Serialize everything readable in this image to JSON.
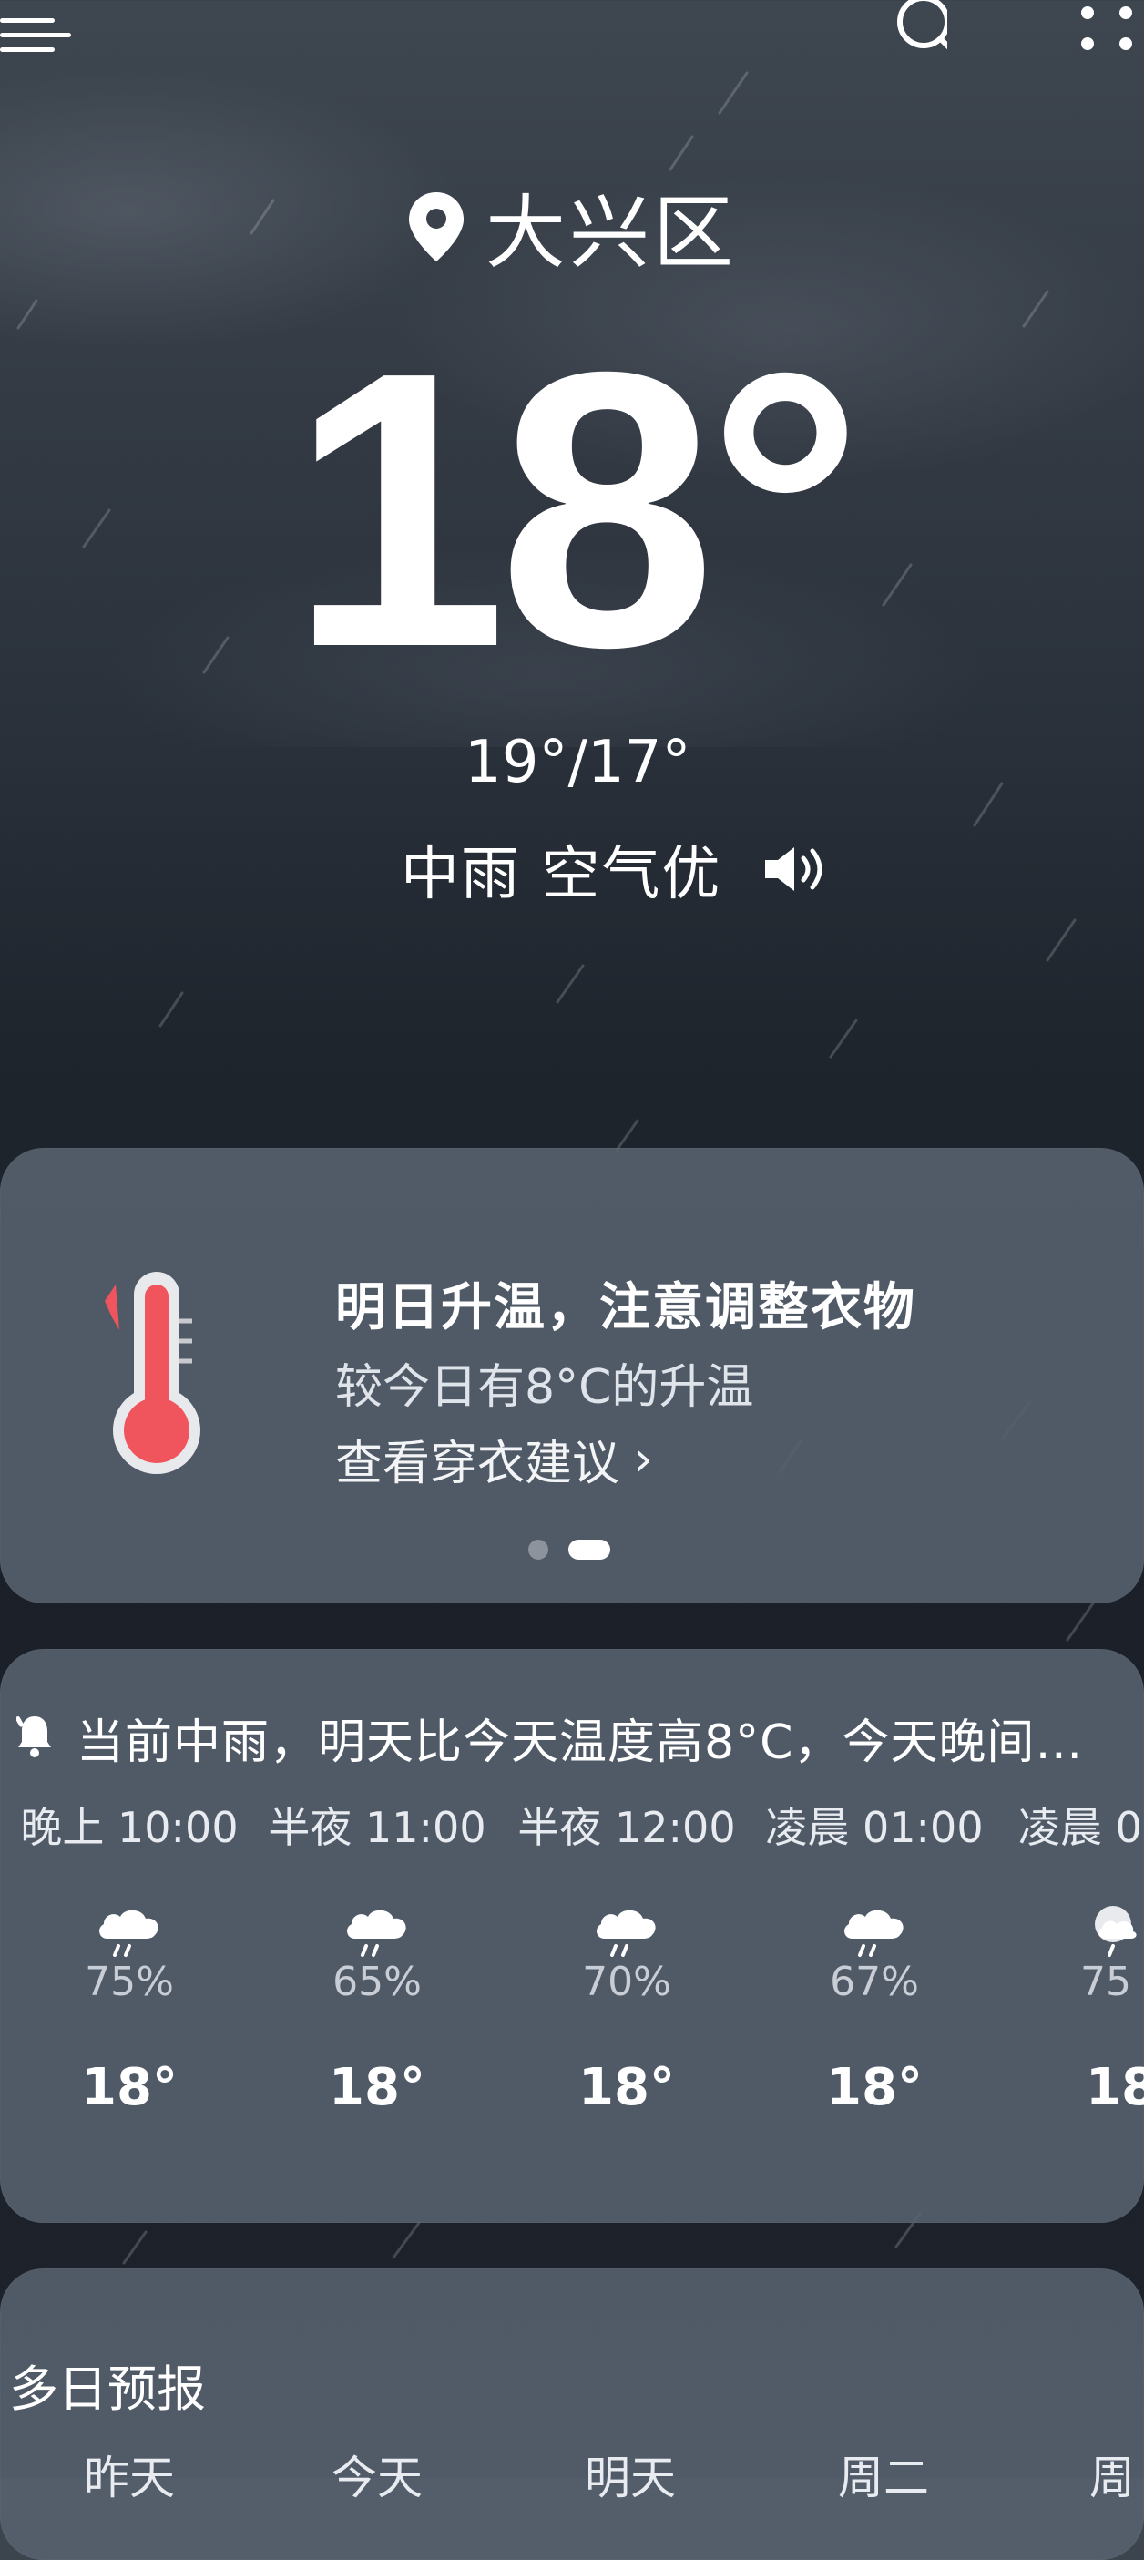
{
  "location": {
    "name": "大兴区"
  },
  "current": {
    "temperature": "18°",
    "range": "19°/17°",
    "condition": "中雨 空气优"
  },
  "tip_card": {
    "title": "明日升温，注意调整衣物",
    "subtitle": "较今日有8°C的升温",
    "link": "查看穿衣建议",
    "link_chevron": "›",
    "page_dots": {
      "count": 2,
      "active": 2
    }
  },
  "hourly": {
    "alert": "当前中雨，明天比今天温度高8°C，今天晚间…",
    "items": [
      {
        "time": "晚上 10:00",
        "pop": "75%",
        "temp": "18°",
        "icon": "rain-cloud-icon"
      },
      {
        "time": "半夜 11:00",
        "pop": "65%",
        "temp": "18°",
        "icon": "rain-cloud-icon"
      },
      {
        "time": "半夜 12:00",
        "pop": "70%",
        "temp": "18°",
        "icon": "rain-cloud-icon"
      },
      {
        "time": "凌晨 01:00",
        "pop": "67%",
        "temp": "18°",
        "icon": "rain-cloud-icon"
      },
      {
        "time": "凌晨 0",
        "pop": "75",
        "temp": "18",
        "icon": "rain-moon-icon"
      }
    ]
  },
  "forecast": {
    "title": "多日预报",
    "days": [
      "昨天",
      "今天",
      "明天",
      "周二",
      "周"
    ]
  },
  "icons": {
    "menu": "menu-icon",
    "search": "search-icon",
    "more": "more-icon",
    "location": "location-pin-icon",
    "speaker": "speaker-icon",
    "thermometer": "thermometer-icon",
    "alert": "alarm-bell-icon"
  },
  "colors": {
    "card_bg": "#56606e",
    "thermometer_red": "#f0545c",
    "text": "#ffffff"
  }
}
